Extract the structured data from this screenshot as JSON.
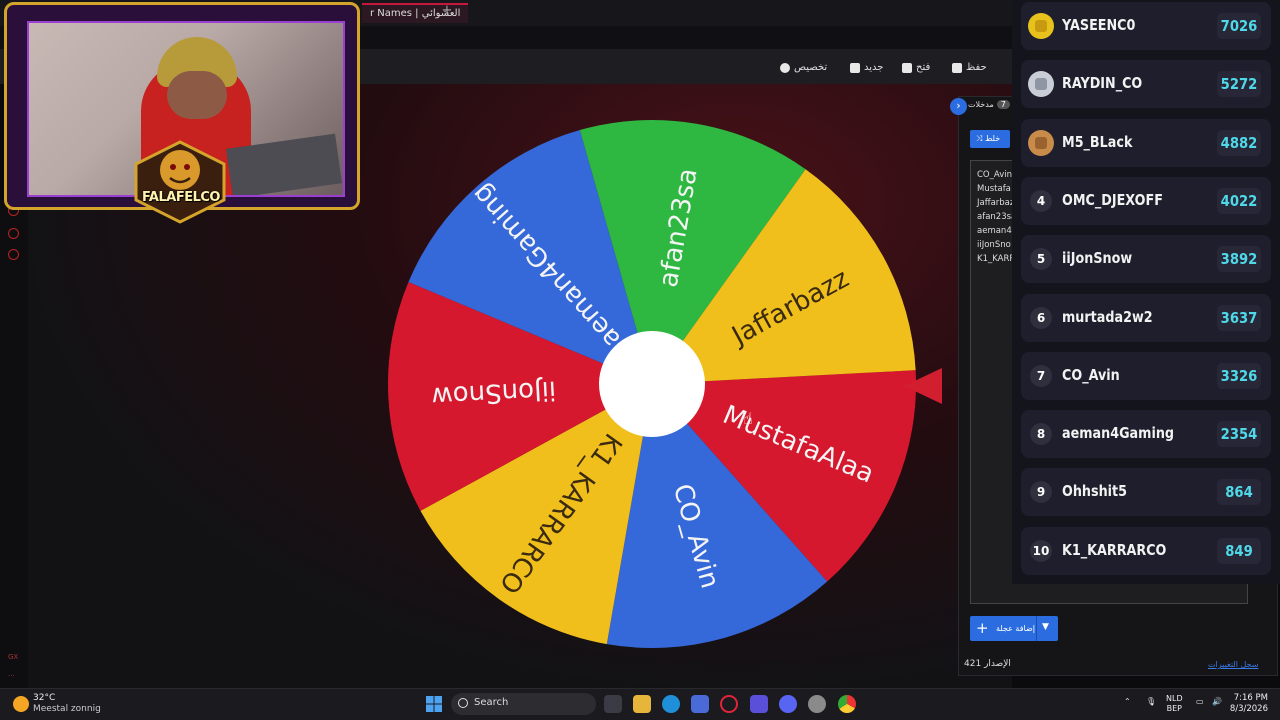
{
  "browser": {
    "tab_title": "العشوائي | Names",
    "tab_prefix": "r Names | العشوائي"
  },
  "toolbar": {
    "customize": "تخصيص",
    "new": "جديد",
    "open": "فتح",
    "save": "حفظ"
  },
  "wheel": {
    "segments": [
      {
        "label": "MustafaAlaa",
        "color": "#d6182f"
      },
      {
        "label": "CO_Avin",
        "color": "#3568d8"
      },
      {
        "label": "K1_KARRARCO",
        "color": "#f0bf1c"
      },
      {
        "label": "iiJonSnow",
        "color": "#d6182f"
      },
      {
        "label": "aeman4Gaming",
        "color": "#3568d8"
      },
      {
        "label": "afan23sa",
        "color": "#2eb842"
      },
      {
        "label": "Jaffarbazz",
        "color": "#f0bf1c"
      }
    ]
  },
  "entries_panel": {
    "tab_label": "مدخلات",
    "count": "7",
    "shuffle_label": "خلط",
    "entries": [
      "CO_Avin",
      "Mustafa",
      "Jaffarbaz",
      "afan23sa",
      "aeman4",
      "iiJonSno",
      "K1_KARR"
    ],
    "add_wheel_label": "إضافة عجلة",
    "version_label": "الإصدار",
    "version_number": "421",
    "changelog_link": "سجل التغييرات"
  },
  "leaderboard": [
    {
      "rank": "",
      "medal": "gold",
      "name": "YASEENC0",
      "score": "7026"
    },
    {
      "rank": "",
      "medal": "silver",
      "name": "RAYDIN_CO",
      "score": "5272"
    },
    {
      "rank": "",
      "medal": "bronze",
      "name": "M5_BLack",
      "score": "4882"
    },
    {
      "rank": "4",
      "medal": "",
      "name": "OMC_DJEXOFF",
      "score": "4022"
    },
    {
      "rank": "5",
      "medal": "",
      "name": "iiJonSnow",
      "score": "3892"
    },
    {
      "rank": "6",
      "medal": "",
      "name": "murtada2w2",
      "score": "3637"
    },
    {
      "rank": "7",
      "medal": "",
      "name": "CO_Avin",
      "score": "3326"
    },
    {
      "rank": "8",
      "medal": "",
      "name": "aeman4Gaming",
      "score": "2354"
    },
    {
      "rank": "9",
      "medal": "",
      "name": "Ohhshit5",
      "score": "864"
    },
    {
      "rank": "10",
      "medal": "",
      "name": "K1_KARRARCO",
      "score": "849"
    }
  ],
  "webcam": {
    "logo_text": "FALAFELCO"
  },
  "taskbar": {
    "weather_temp": "32°C",
    "weather_desc": "Meestal zonnig",
    "search_label": "Search",
    "lang_top": "NLD",
    "lang_bottom": "BEP",
    "time": "7:16 PM",
    "date": "8/3/2026"
  },
  "colors": {
    "accent": "#2b6de0",
    "score": "#4fd8e8",
    "pointer": "#d21f30"
  }
}
